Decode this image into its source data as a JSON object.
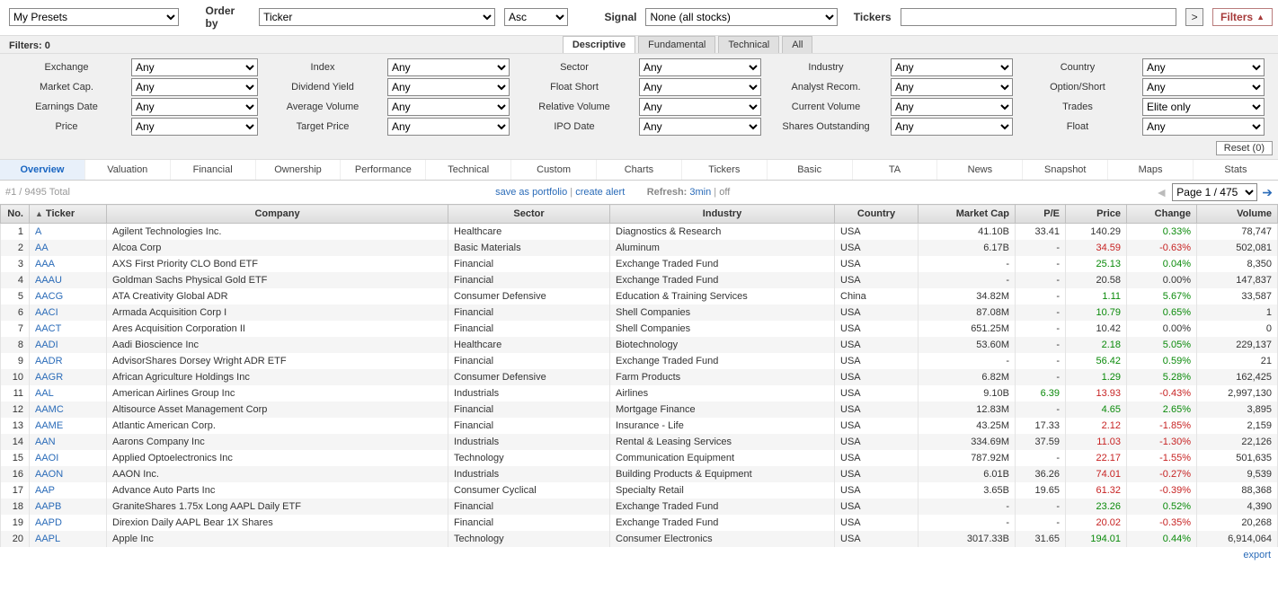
{
  "top": {
    "presets_label": "My Presets",
    "orderby_label": "Order by",
    "orderby_value": "Ticker",
    "dir_value": "Asc",
    "signal_label": "Signal",
    "signal_value": "None (all stocks)",
    "tickers_label": "Tickers",
    "go": ">",
    "filters_btn": "Filters"
  },
  "filters": {
    "count_label": "Filters: 0",
    "tabs": [
      "Descriptive",
      "Fundamental",
      "Technical",
      "All"
    ],
    "any": "Any",
    "elite": "Elite only",
    "rows": [
      [
        "Exchange",
        "Index",
        "Sector",
        "Industry",
        "Country"
      ],
      [
        "Market Cap.",
        "Dividend Yield",
        "Float Short",
        "Analyst Recom.",
        "Option/Short"
      ],
      [
        "Earnings Date",
        "Average Volume",
        "Relative Volume",
        "Current Volume",
        "Trades"
      ],
      [
        "Price",
        "Target Price",
        "IPO Date",
        "Shares Outstanding",
        "Float"
      ]
    ],
    "reset": "Reset (0)"
  },
  "viewtabs": [
    "Overview",
    "Valuation",
    "Financial",
    "Ownership",
    "Performance",
    "Technical",
    "Custom",
    "Charts",
    "Tickers",
    "Basic",
    "TA",
    "News",
    "Snapshot",
    "Maps",
    "Stats"
  ],
  "subbar": {
    "total": "#1 / 9495 Total",
    "save": "save as portfolio",
    "alert": "create alert",
    "refresh_label": "Refresh:",
    "refresh_time": "3min",
    "off": "off",
    "page_sel": "Page 1 / 475"
  },
  "headers": [
    "No.",
    "Ticker",
    "Company",
    "Sector",
    "Industry",
    "Country",
    "Market Cap",
    "P/E",
    "Price",
    "Change",
    "Volume"
  ],
  "rows": [
    {
      "n": 1,
      "t": "A",
      "c": "Agilent Technologies Inc.",
      "s": "Healthcare",
      "i": "Diagnostics & Research",
      "co": "USA",
      "mc": "41.10B",
      "pe": "33.41",
      "pr": "140.29",
      "ch": "0.33%",
      "chp": true,
      "v": "78,747"
    },
    {
      "n": 2,
      "t": "AA",
      "c": "Alcoa Corp",
      "s": "Basic Materials",
      "i": "Aluminum",
      "co": "USA",
      "mc": "6.17B",
      "pe": "-",
      "pr": "34.59",
      "prp": false,
      "ch": "-0.63%",
      "chp": false,
      "v": "502,081"
    },
    {
      "n": 3,
      "t": "AAA",
      "c": "AXS First Priority CLO Bond ETF",
      "s": "Financial",
      "i": "Exchange Traded Fund",
      "co": "USA",
      "mc": "-",
      "pe": "-",
      "pr": "25.13",
      "prp": true,
      "ch": "0.04%",
      "chp": true,
      "v": "8,350"
    },
    {
      "n": 4,
      "t": "AAAU",
      "c": "Goldman Sachs Physical Gold ETF",
      "s": "Financial",
      "i": "Exchange Traded Fund",
      "co": "USA",
      "mc": "-",
      "pe": "-",
      "pr": "20.58",
      "ch": "0.00%",
      "v": "147,837"
    },
    {
      "n": 5,
      "t": "AACG",
      "c": "ATA Creativity Global ADR",
      "s": "Consumer Defensive",
      "i": "Education & Training Services",
      "co": "China",
      "mc": "34.82M",
      "pe": "-",
      "pr": "1.11",
      "prp": true,
      "ch": "5.67%",
      "chp": true,
      "v": "33,587"
    },
    {
      "n": 6,
      "t": "AACI",
      "c": "Armada Acquisition Corp I",
      "s": "Financial",
      "i": "Shell Companies",
      "co": "USA",
      "mc": "87.08M",
      "pe": "-",
      "pr": "10.79",
      "prp": true,
      "ch": "0.65%",
      "chp": true,
      "v": "1"
    },
    {
      "n": 7,
      "t": "AACT",
      "c": "Ares Acquisition Corporation II",
      "s": "Financial",
      "i": "Shell Companies",
      "co": "USA",
      "mc": "651.25M",
      "pe": "-",
      "pr": "10.42",
      "ch": "0.00%",
      "v": "0"
    },
    {
      "n": 8,
      "t": "AADI",
      "c": "Aadi Bioscience Inc",
      "s": "Healthcare",
      "i": "Biotechnology",
      "co": "USA",
      "mc": "53.60M",
      "pe": "-",
      "pr": "2.18",
      "prp": true,
      "ch": "5.05%",
      "chp": true,
      "v": "229,137"
    },
    {
      "n": 9,
      "t": "AADR",
      "c": "AdvisorShares Dorsey Wright ADR ETF",
      "s": "Financial",
      "i": "Exchange Traded Fund",
      "co": "USA",
      "mc": "-",
      "pe": "-",
      "pr": "56.42",
      "prp": true,
      "ch": "0.59%",
      "chp": true,
      "v": "21"
    },
    {
      "n": 10,
      "t": "AAGR",
      "c": "African Agriculture Holdings Inc",
      "s": "Consumer Defensive",
      "i": "Farm Products",
      "co": "USA",
      "mc": "6.82M",
      "pe": "-",
      "pr": "1.29",
      "prp": true,
      "ch": "5.28%",
      "chp": true,
      "v": "162,425"
    },
    {
      "n": 11,
      "t": "AAL",
      "c": "American Airlines Group Inc",
      "s": "Industrials",
      "i": "Airlines",
      "co": "USA",
      "mc": "9.10B",
      "pe": "6.39",
      "pep": true,
      "pr": "13.93",
      "prp": false,
      "ch": "-0.43%",
      "chp": false,
      "v": "2,997,130"
    },
    {
      "n": 12,
      "t": "AAMC",
      "c": "Altisource Asset Management Corp",
      "s": "Financial",
      "i": "Mortgage Finance",
      "co": "USA",
      "mc": "12.83M",
      "pe": "-",
      "pr": "4.65",
      "prp": true,
      "ch": "2.65%",
      "chp": true,
      "v": "3,895"
    },
    {
      "n": 13,
      "t": "AAME",
      "c": "Atlantic American Corp.",
      "s": "Financial",
      "i": "Insurance - Life",
      "co": "USA",
      "mc": "43.25M",
      "pe": "17.33",
      "pr": "2.12",
      "prp": false,
      "ch": "-1.85%",
      "chp": false,
      "v": "2,159"
    },
    {
      "n": 14,
      "t": "AAN",
      "c": "Aarons Company Inc",
      "s": "Industrials",
      "i": "Rental & Leasing Services",
      "co": "USA",
      "mc": "334.69M",
      "pe": "37.59",
      "pr": "11.03",
      "prp": false,
      "ch": "-1.30%",
      "chp": false,
      "v": "22,126"
    },
    {
      "n": 15,
      "t": "AAOI",
      "c": "Applied Optoelectronics Inc",
      "s": "Technology",
      "i": "Communication Equipment",
      "co": "USA",
      "mc": "787.92M",
      "pe": "-",
      "pr": "22.17",
      "prp": false,
      "ch": "-1.55%",
      "chp": false,
      "v": "501,635"
    },
    {
      "n": 16,
      "t": "AAON",
      "c": "AAON Inc.",
      "s": "Industrials",
      "i": "Building Products & Equipment",
      "co": "USA",
      "mc": "6.01B",
      "pe": "36.26",
      "pr": "74.01",
      "prp": false,
      "ch": "-0.27%",
      "chp": false,
      "v": "9,539"
    },
    {
      "n": 17,
      "t": "AAP",
      "c": "Advance Auto Parts Inc",
      "s": "Consumer Cyclical",
      "i": "Specialty Retail",
      "co": "USA",
      "mc": "3.65B",
      "pe": "19.65",
      "pr": "61.32",
      "prp": false,
      "ch": "-0.39%",
      "chp": false,
      "v": "88,368"
    },
    {
      "n": 18,
      "t": "AAPB",
      "c": "GraniteShares 1.75x Long AAPL Daily ETF",
      "s": "Financial",
      "i": "Exchange Traded Fund",
      "co": "USA",
      "mc": "-",
      "pe": "-",
      "pr": "23.26",
      "prp": true,
      "ch": "0.52%",
      "chp": true,
      "v": "4,390"
    },
    {
      "n": 19,
      "t": "AAPD",
      "c": "Direxion Daily AAPL Bear 1X Shares",
      "s": "Financial",
      "i": "Exchange Traded Fund",
      "co": "USA",
      "mc": "-",
      "pe": "-",
      "pr": "20.02",
      "prp": false,
      "ch": "-0.35%",
      "chp": false,
      "v": "20,268"
    },
    {
      "n": 20,
      "t": "AAPL",
      "c": "Apple Inc",
      "s": "Technology",
      "i": "Consumer Electronics",
      "co": "USA",
      "mc": "3017.33B",
      "pe": "31.65",
      "pr": "194.01",
      "prp": true,
      "ch": "0.44%",
      "chp": true,
      "v": "6,914,064"
    }
  ],
  "export": "export"
}
